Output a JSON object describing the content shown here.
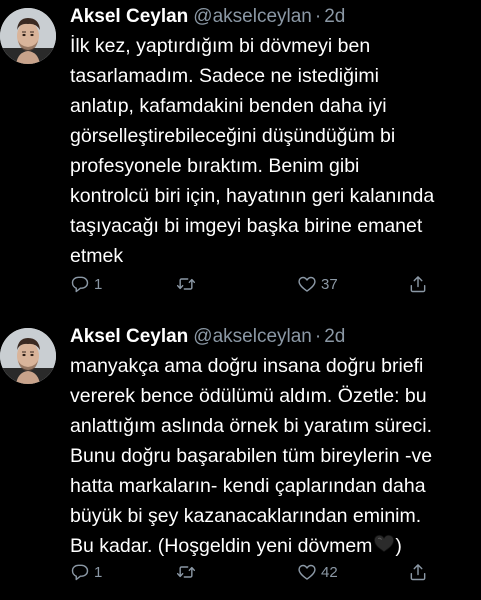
{
  "tweets": [
    {
      "name": "Aksel Ceylan",
      "handle": "@akselceylan",
      "dot": "·",
      "time": "2d",
      "lines": [
        "İlk kez, yaptırdığım bi dövmeyi ben",
        "tasarlamadım. Sadece ne istediğimi",
        "anlatıp, kafamdakini benden daha iyi",
        "görselleştirebileceğini düşündüğüm bi",
        "profesyonele bıraktım. Benim gibi",
        "kontrolcü biri için, hayatının geri kalanında",
        "taşıyacağı bi imgeyi başka birine emanet",
        "etmek"
      ],
      "reply_count": "1",
      "like_count": "37"
    },
    {
      "name": "Aksel Ceylan",
      "handle": "@akselceylan",
      "dot": "·",
      "time": "2d",
      "lines": [
        "manyakça ama doğru insana doğru briefi",
        "vererek bence ödülümü aldım. Özetle: bu",
        "anlattığım aslında örnek bi yaratım süreci.",
        "Bunu doğru başarabilen tüm bireylerin -ve",
        "hatta markaların- kendi çaplarından daha",
        "büyük bi şey kazanacaklarından eminim.",
        "Bu kadar. (Hoşgeldin yeni dövmem",
        ")"
      ],
      "reply_count": "1",
      "like_count": "42"
    }
  ],
  "icons": {
    "reply": "reply-icon",
    "retweet": "retweet-icon",
    "like": "like-icon",
    "share": "share-icon",
    "emoji": "black-heart-emoji"
  },
  "colors": {
    "background": "#000000",
    "text": "#ffffff",
    "secondary": "#8b98a5"
  }
}
